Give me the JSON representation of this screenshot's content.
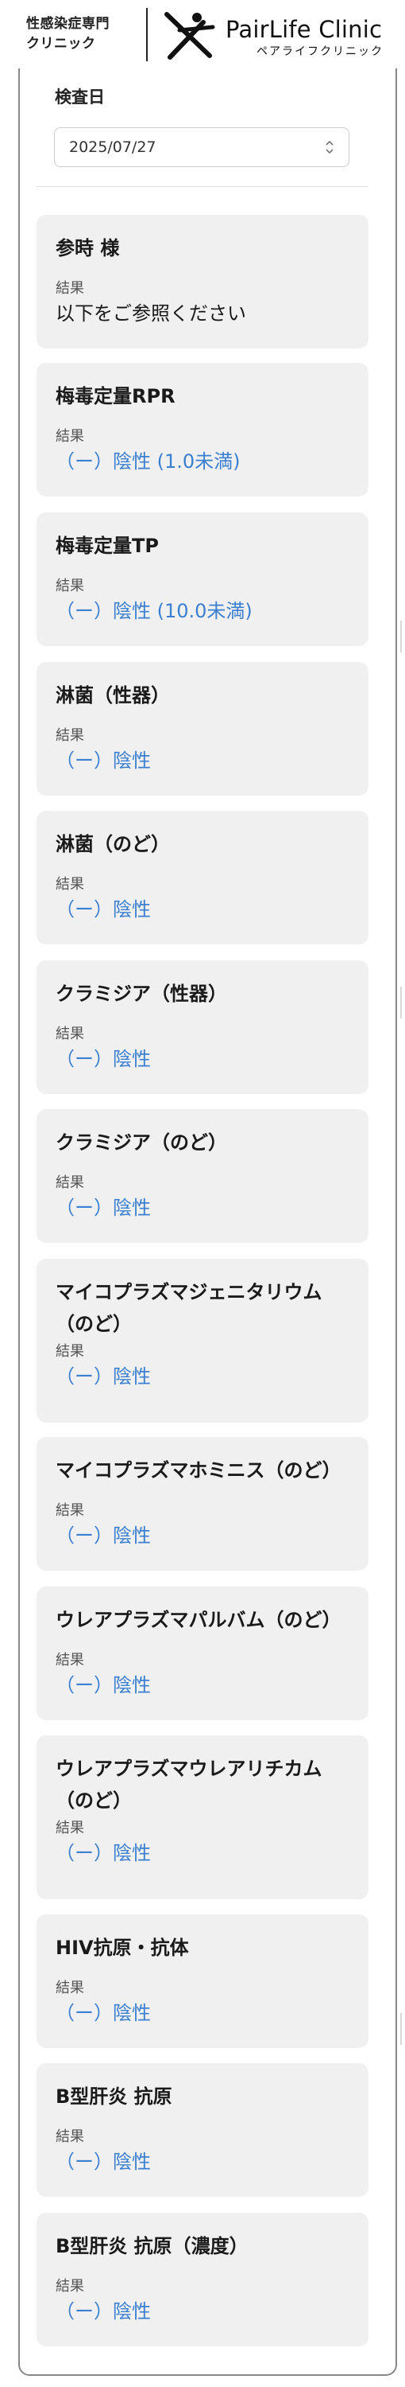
{
  "header": {
    "left_line1": "性感染症専門",
    "left_line2": "クリニック",
    "logo_title": "PairLife Clinic",
    "logo_sub": "ペアライフクリニック"
  },
  "exam_date": {
    "label": "検査日",
    "value": "2025/07/27"
  },
  "results_label": "結果",
  "cards": [
    {
      "title": "参時 様",
      "value": "以下をご参照ください",
      "style": "dark"
    },
    {
      "title": "梅毒定量RPR",
      "value": "（ー）陰性 (1.0未満)",
      "style": "blue"
    },
    {
      "title": "梅毒定量TP",
      "value": "（ー）陰性 (10.0未満)",
      "style": "blue"
    },
    {
      "title": "淋菌（性器）",
      "value": "（ー）陰性",
      "style": "blue"
    },
    {
      "title": "淋菌（のど）",
      "value": "（ー）陰性",
      "style": "blue"
    },
    {
      "title": "クラミジア（性器）",
      "value": "（ー）陰性",
      "style": "blue"
    },
    {
      "title": "クラミジア（のど）",
      "value": "（ー）陰性",
      "style": "blue"
    },
    {
      "title": "マイコプラズマジェニタリウム（のど）",
      "value": "（ー）陰性",
      "style": "blue"
    },
    {
      "title": "マイコプラズマホミニス（のど）",
      "value": "（ー）陰性",
      "style": "blue"
    },
    {
      "title": "ウレアプラズマパルバム（のど）",
      "value": "（ー）陰性",
      "style": "blue"
    },
    {
      "title": "ウレアプラズマウレアリチカム（のど）",
      "value": "（ー）陰性",
      "style": "blue"
    },
    {
      "title": "HIV抗原・抗体",
      "value": "（ー）陰性",
      "style": "blue"
    },
    {
      "title": "B型肝炎 抗原",
      "value": "（ー）陰性",
      "style": "blue"
    },
    {
      "title": "B型肝炎 抗原（濃度）",
      "value": "（ー）陰性",
      "style": "blue"
    }
  ],
  "colors": {
    "result_blue": "#3a7fd0",
    "card_bg": "#f0f0f0",
    "panel_border": "#888888"
  }
}
